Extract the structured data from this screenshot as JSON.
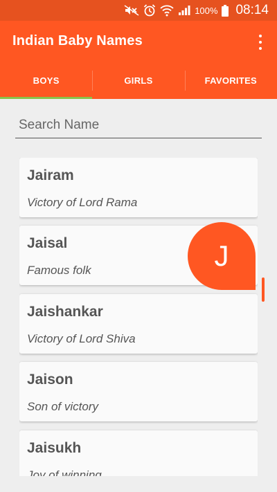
{
  "status_bar": {
    "battery": "100%",
    "time": "08:14",
    "icons": [
      "mute-icon",
      "alarm-icon",
      "wifi-icon",
      "signal-icon",
      "battery-icon"
    ]
  },
  "app_bar": {
    "title": "Indian Baby Names",
    "menu_icon": "overflow-menu-icon"
  },
  "tabs": [
    {
      "label": "BOYS",
      "selected": true
    },
    {
      "label": "GIRLS",
      "selected": false
    },
    {
      "label": "FAVORITES",
      "selected": false
    }
  ],
  "search": {
    "placeholder": "Search Name",
    "value": ""
  },
  "names": [
    {
      "name": "Jairam",
      "meaning": "Victory of Lord Rama"
    },
    {
      "name": "Jaisal",
      "meaning": "Famous folk"
    },
    {
      "name": "Jaishankar",
      "meaning": "Victory of Lord Shiva"
    },
    {
      "name": "Jaison",
      "meaning": "Son of victory"
    },
    {
      "name": "Jaisukh",
      "meaning": "Joy of winning"
    }
  ],
  "fast_scroll_letter": "J",
  "colors": {
    "primary": "#ff5722",
    "primary_dark": "#e6521f",
    "tab_indicator": "#8bc34a",
    "background": "#eeeeee"
  }
}
